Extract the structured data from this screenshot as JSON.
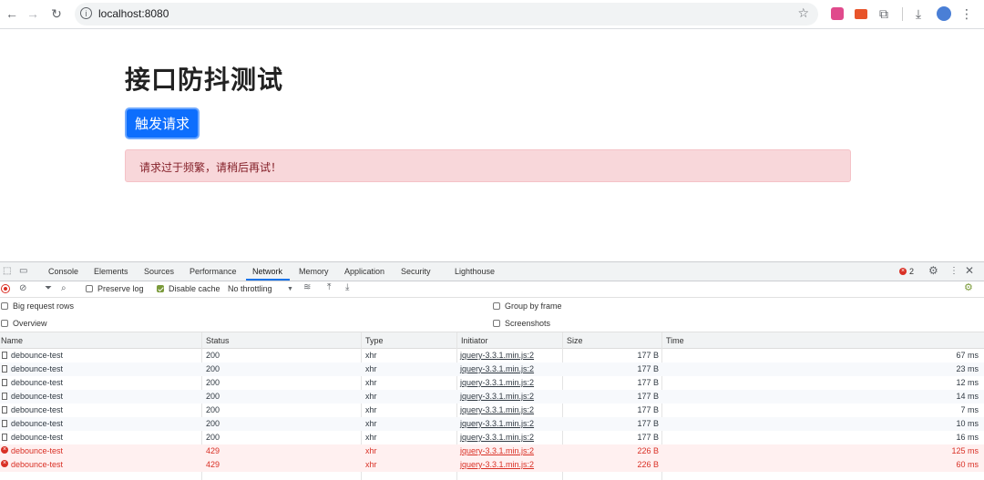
{
  "browser": {
    "url": "localhost:8080",
    "nav_icons": {
      "back": "←",
      "forward": "→",
      "reload": "↻"
    }
  },
  "page": {
    "title": "接口防抖测试",
    "button_label": "触发请求",
    "alert_text": "请求过于频繁，请稍后再试！"
  },
  "devtools": {
    "tabs": [
      "Console",
      "Elements",
      "Sources",
      "Performance",
      "Network",
      "Memory",
      "Application",
      "Security",
      "Lighthouse"
    ],
    "active_tab": "Network",
    "error_count": "2",
    "toolbar": {
      "preserve_log": "Preserve log",
      "disable_cache": "Disable cache",
      "throttling": "No throttling"
    },
    "settings": {
      "big_request_rows": "Big request rows",
      "overview": "Overview",
      "group_by_frame": "Group by frame",
      "screenshots": "Screenshots"
    },
    "columns": [
      "Name",
      "Status",
      "Type",
      "Initiator",
      "Size",
      "Time"
    ],
    "rows": [
      {
        "name": "debounce-test",
        "status": "200",
        "type": "xhr",
        "initiator": "jquery-3.3.1.min.js:2",
        "size": "177 B",
        "time": "67 ms",
        "error": false
      },
      {
        "name": "debounce-test",
        "status": "200",
        "type": "xhr",
        "initiator": "jquery-3.3.1.min.js:2",
        "size": "177 B",
        "time": "23 ms",
        "error": false
      },
      {
        "name": "debounce-test",
        "status": "200",
        "type": "xhr",
        "initiator": "jquery-3.3.1.min.js:2",
        "size": "177 B",
        "time": "12 ms",
        "error": false
      },
      {
        "name": "debounce-test",
        "status": "200",
        "type": "xhr",
        "initiator": "jquery-3.3.1.min.js:2",
        "size": "177 B",
        "time": "14 ms",
        "error": false
      },
      {
        "name": "debounce-test",
        "status": "200",
        "type": "xhr",
        "initiator": "jquery-3.3.1.min.js:2",
        "size": "177 B",
        "time": "7 ms",
        "error": false
      },
      {
        "name": "debounce-test",
        "status": "200",
        "type": "xhr",
        "initiator": "jquery-3.3.1.min.js:2",
        "size": "177 B",
        "time": "10 ms",
        "error": false
      },
      {
        "name": "debounce-test",
        "status": "200",
        "type": "xhr",
        "initiator": "jquery-3.3.1.min.js:2",
        "size": "177 B",
        "time": "16 ms",
        "error": false
      },
      {
        "name": "debounce-test",
        "status": "429",
        "type": "xhr",
        "initiator": "jquery-3.3.1.min.js:2",
        "size": "226 B",
        "time": "125 ms",
        "error": true
      },
      {
        "name": "debounce-test",
        "status": "429",
        "type": "xhr",
        "initiator": "jquery-3.3.1.min.js:2",
        "size": "226 B",
        "time": "60 ms",
        "error": true
      }
    ]
  },
  "colors": {
    "primary_button": "#0d6efd",
    "alert_bg": "#f8d7da",
    "alert_text": "#842029",
    "error_red": "#d93025"
  }
}
